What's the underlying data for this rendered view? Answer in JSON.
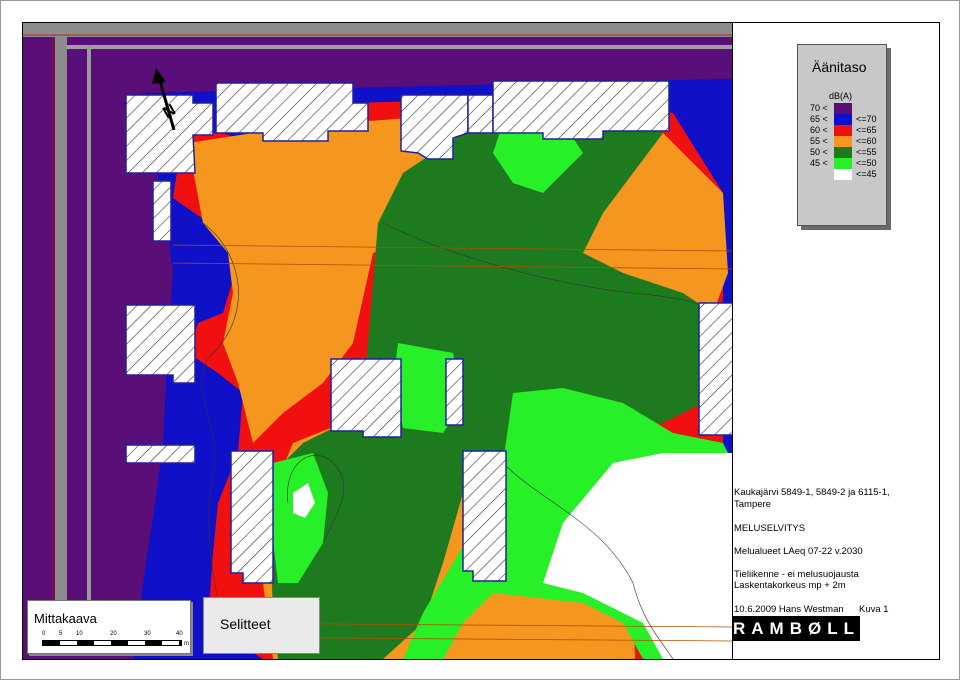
{
  "legend": {
    "title": "Äänitaso",
    "unit": "dB(A)",
    "rows": [
      {
        "low": "70 <",
        "high": "",
        "color": "#5a0f78"
      },
      {
        "low": "65 <",
        "high": "<=70",
        "color": "#1010c8"
      },
      {
        "low": "60 <",
        "high": "<=65",
        "color": "#f01010"
      },
      {
        "low": "55 <",
        "high": "<=60",
        "color": "#f5961e"
      },
      {
        "low": "50 <",
        "high": "<=55",
        "color": "#1e7a1e"
      },
      {
        "low": "45 <",
        "high": "<=50",
        "color": "#28f028"
      },
      {
        "low": "",
        "high": "<=45",
        "color": "#ffffff"
      }
    ]
  },
  "info": {
    "location": "Kaukajärvi 5849-1, 5849-2 ja 6115-1,",
    "city": "Tampere",
    "report": "MELUSELVITYS",
    "map_desc": "Melualueet LAeq 07-22 v.2030",
    "scenario": "Tieliikenne - ei melusuojausta",
    "calc_height": "Laskentakorkeus mp + 2m",
    "date_author": "10.6.2009  Hans Westman",
    "figure": "Kuva 1",
    "logo": "RAMBØLL"
  },
  "scale": {
    "title": "Mittakaava",
    "ticks": [
      "0",
      "5",
      "10",
      "20",
      "30",
      "40"
    ],
    "unit": "m"
  },
  "selitteet": "Selitteet",
  "north_label": "N"
}
